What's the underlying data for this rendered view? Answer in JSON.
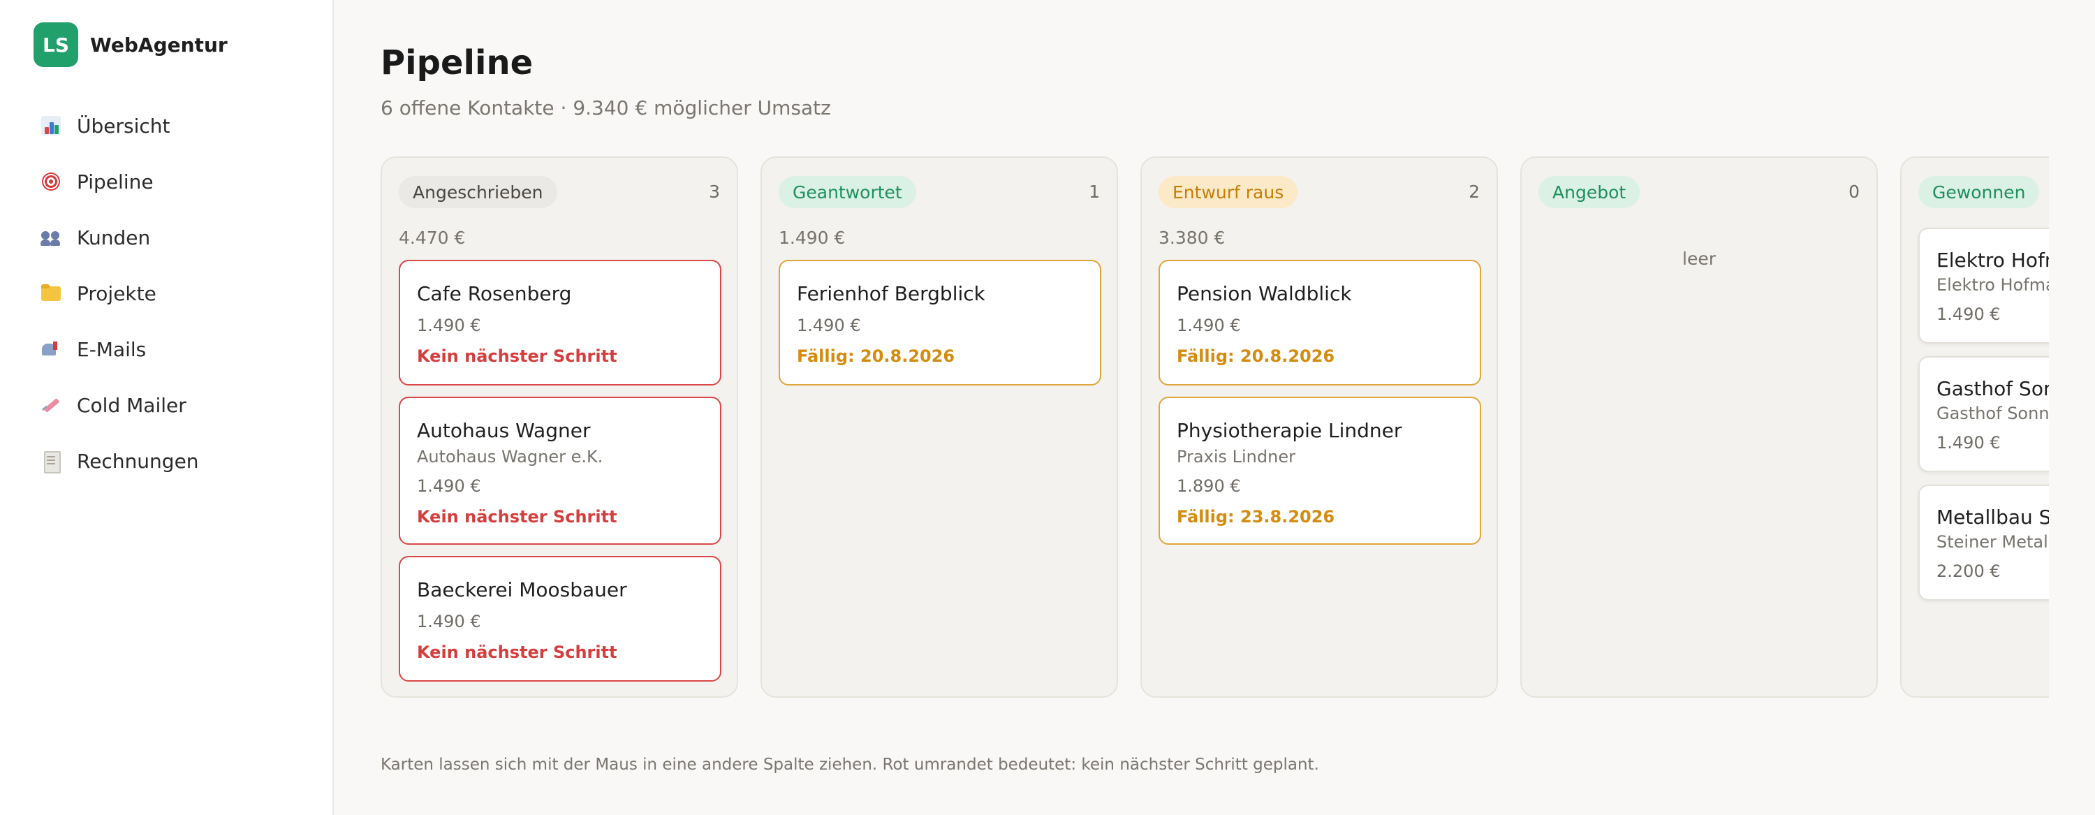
{
  "brand": {
    "logo_text": "LS",
    "name": "WebAgentur",
    "color": "#21a06b"
  },
  "sidebar": {
    "items": [
      {
        "label": "Übersicht",
        "icon": "bar-chart-icon"
      },
      {
        "label": "Pipeline",
        "icon": "target-icon"
      },
      {
        "label": "Kunden",
        "icon": "people-icon"
      },
      {
        "label": "Projekte",
        "icon": "folder-icon"
      },
      {
        "label": "E-Mails",
        "icon": "mailbox-icon"
      },
      {
        "label": "Cold Mailer",
        "icon": "syringe-icon"
      },
      {
        "label": "Rechnungen",
        "icon": "receipt-icon"
      }
    ]
  },
  "header": {
    "title": "Pipeline",
    "subtitle": "6 offene Kontakte · 9.340 € möglicher Umsatz"
  },
  "columns": [
    {
      "label": "Angeschrieben",
      "count": "3",
      "sum": "4.470 €",
      "badge_color": "#ebe9e5",
      "badge_text_color": "#4a4743",
      "cards": [
        {
          "title": "Cafe Rosenberg",
          "subtitle": "",
          "amount": "1.490 €",
          "status": "Kein nächster Schritt"
        },
        {
          "title": "Autohaus Wagner",
          "subtitle": "Autohaus Wagner e.K.",
          "amount": "1.490 €",
          "status": "Kein nächster Schritt"
        },
        {
          "title": "Baeckerei Moosbauer",
          "subtitle": "",
          "amount": "1.490 €",
          "status": "Kein nächster Schritt"
        }
      ]
    },
    {
      "label": "Geantwortet",
      "count": "1",
      "sum": "1.490 €",
      "badge_color": "#dcf1e6",
      "badge_text_color": "#1e8f5c",
      "cards": [
        {
          "title": "Ferienhof Bergblick",
          "subtitle": "",
          "amount": "1.490 €",
          "status": "Fällig: 20.8.2026"
        }
      ]
    },
    {
      "label": "Entwurf raus",
      "count": "2",
      "sum": "3.380 €",
      "badge_color": "#fbe9c8",
      "badge_text_color": "#c47f06",
      "cards": [
        {
          "title": "Pension Waldblick",
          "subtitle": "",
          "amount": "1.490 €",
          "status": "Fällig: 20.8.2026"
        },
        {
          "title": "Physiotherapie Lindner",
          "subtitle": "Praxis Lindner",
          "amount": "1.890 €",
          "status": "Fällig: 23.8.2026"
        }
      ]
    },
    {
      "label": "Angebot",
      "count": "0",
      "sum": "",
      "badge_color": "#dcf1e6",
      "badge_text_color": "#1e8f5c",
      "empty_text": "leer",
      "cards": []
    },
    {
      "label": "Gewonnen",
      "count": "",
      "sum": "",
      "badge_color": "#dcf1e6",
      "badge_text_color": "#1e8f5c",
      "cards": [
        {
          "title": "Elektro Hofmann",
          "subtitle": "Elektro Hofmann",
          "amount": "1.490 €"
        },
        {
          "title": "Gasthof Sonne",
          "subtitle": "Gasthof Sonne",
          "amount": "1.490 €"
        },
        {
          "title": "Metallbau Steiner",
          "subtitle": "Steiner Metallbau",
          "amount": "2.200 €"
        }
      ]
    }
  ],
  "footer_note": "Karten lassen sich mit der Maus in eine andere Spalte ziehen. Rot umrandet bedeutet: kein nächster Schritt geplant."
}
